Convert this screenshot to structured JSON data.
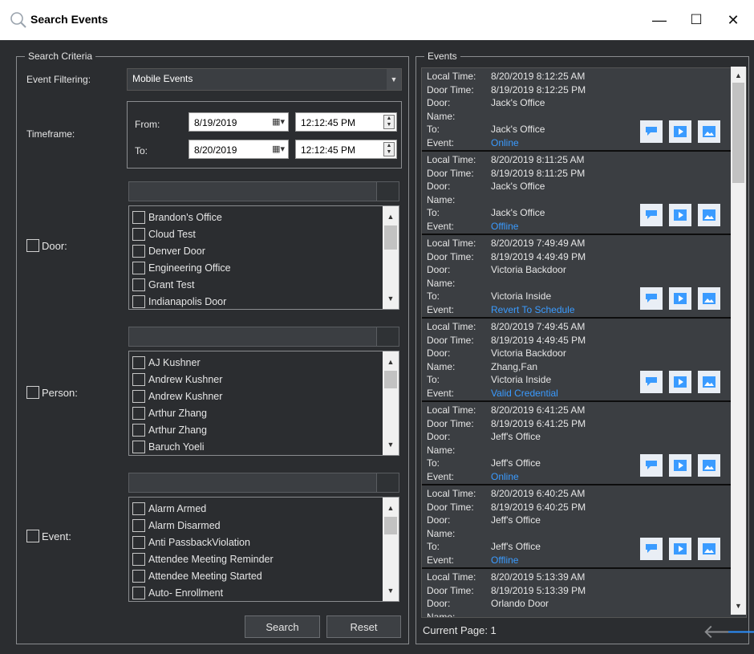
{
  "window": {
    "title": "Search Events",
    "minimize_glyph": "—",
    "maximize_glyph": "☐",
    "close_glyph": "✕"
  },
  "criteria": {
    "legend": "Search Criteria",
    "event_filtering_label": "Event Filtering:",
    "event_filtering_value": "Mobile Events",
    "timeframe_label": "Timeframe:",
    "from_label": "From:",
    "to_label": "To:",
    "from_date": "8/19/2019",
    "from_time": "12:12:45 PM",
    "to_date": "8/20/2019",
    "to_time": "12:12:45 PM",
    "door_label": "Door:",
    "person_label": "Person:",
    "event_label": "Event:",
    "door_items": [
      "Brandon's Office",
      "Cloud Test",
      "Denver Door",
      "Engineering Office",
      "Grant Test",
      "Indianapolis Door"
    ],
    "person_items": [
      "AJ Kushner",
      "Andrew Kushner",
      "Andrew Kushner",
      "Arthur Zhang",
      "Arthur Zhang",
      "Baruch Yoeli"
    ],
    "event_items": [
      "Alarm Armed",
      "Alarm Disarmed",
      "Anti PassbackViolation",
      "Attendee Meeting Reminder",
      "Attendee Meeting Started",
      "Auto- Enrollment"
    ],
    "search_label": "Search",
    "reset_label": "Reset"
  },
  "events_panel": {
    "legend": "Events",
    "keys": {
      "local_time": "Local Time:",
      "door_time": "Door Time:",
      "door": "Door:",
      "name": "Name:",
      "to": "To:",
      "event": "Event:"
    },
    "events": [
      {
        "local_time": "8/20/2019 8:12:25 AM",
        "door_time": "8/19/2019 8:12:25 PM",
        "door": "Jack's Office",
        "name": "",
        "to": "Jack's Office",
        "event": "Online"
      },
      {
        "local_time": "8/20/2019 8:11:25 AM",
        "door_time": "8/19/2019 8:11:25 PM",
        "door": "Jack's Office",
        "name": "",
        "to": "Jack's Office",
        "event": "Offline"
      },
      {
        "local_time": "8/20/2019 7:49:49 AM",
        "door_time": "8/19/2019 4:49:49 PM",
        "door": "Victoria Backdoor",
        "name": "",
        "to": "Victoria Inside",
        "event": "Revert To Schedule"
      },
      {
        "local_time": "8/20/2019 7:49:45 AM",
        "door_time": "8/19/2019 4:49:45 PM",
        "door": "Victoria Backdoor",
        "name": "Zhang,Fan",
        "to": "Victoria Inside",
        "event": "Valid Credential"
      },
      {
        "local_time": "8/20/2019 6:41:25 AM",
        "door_time": "8/19/2019 6:41:25 PM",
        "door": "Jeff's Office",
        "name": "",
        "to": "Jeff's Office",
        "event": "Online"
      },
      {
        "local_time": "8/20/2019 6:40:25 AM",
        "door_time": "8/19/2019 6:40:25 PM",
        "door": "Jeff's Office",
        "name": "",
        "to": "Jeff's Office",
        "event": "Offline"
      },
      {
        "local_time": "8/20/2019 5:13:39 AM",
        "door_time": "8/19/2019 5:13:39 PM",
        "door": "Orlando Door",
        "name": "",
        "to": "",
        "event": ""
      }
    ],
    "current_page_label": "Current Page: 1"
  },
  "colors": {
    "background": "#2b2d30",
    "link": "#3a9bff",
    "icon_blue": "#3a9bff",
    "nav_arrow_active": "#2b8fff",
    "nav_arrow_disabled": "#8a8c8f"
  }
}
